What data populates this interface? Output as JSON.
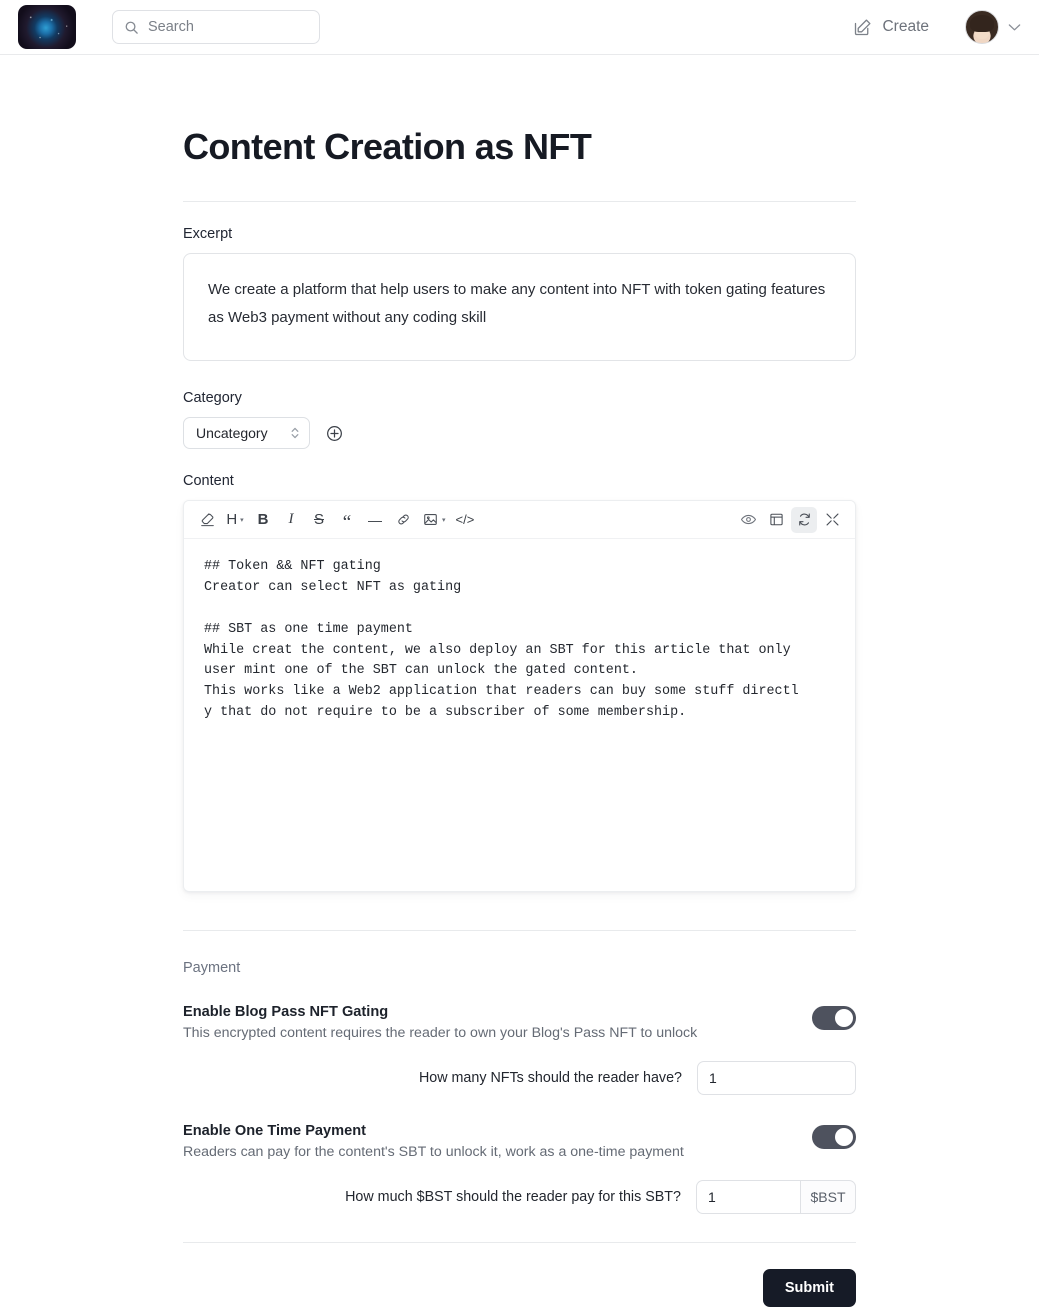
{
  "header": {
    "logo_alt": "app-logo",
    "search": {
      "placeholder": "Search"
    },
    "create_label": "Create",
    "account_caret": "⌄"
  },
  "page": {
    "title": "Content Creation as NFT"
  },
  "excerpt": {
    "label": "Excerpt",
    "value": "We create a platform that help users to make any content into NFT with token gating features as Web3 payment without any coding skill",
    "placeholder": "Excerpt"
  },
  "category": {
    "label": "Category",
    "selected": "Uncategory",
    "options": [
      "Uncategory"
    ],
    "add_button_title": "Add category"
  },
  "content": {
    "label": "Content",
    "toolbar_left": [
      {
        "name": "clear-format-icon",
        "label": ""
      },
      {
        "name": "heading-icon",
        "label": "H",
        "caret": "▾"
      },
      {
        "name": "bold-icon",
        "label": "B"
      },
      {
        "name": "italic-icon",
        "label": "I"
      },
      {
        "name": "strikethrough-icon",
        "label": "S"
      },
      {
        "name": "blockquote-icon",
        "label": "“"
      },
      {
        "name": "horizontal-rule-icon",
        "label": "—"
      },
      {
        "name": "link-icon",
        "label": ""
      },
      {
        "name": "image-icon",
        "label": "",
        "caret": "▾"
      },
      {
        "name": "code-icon",
        "label": "</>"
      }
    ],
    "toolbar_right": [
      {
        "name": "preview-eye-icon",
        "active": false
      },
      {
        "name": "split-view-icon",
        "active": false
      },
      {
        "name": "sync-refresh-icon",
        "active": true
      },
      {
        "name": "fullscreen-icon",
        "active": false
      }
    ],
    "markdown": "## Token && NFT gating\nCreator can select NFT as gating\n\n## SBT as one time payment\nWhile creat the content, we also deploy an SBT for this article that only\nuser mint one of the SBT can unlock the gated content.\nThis works like a Web2 application that readers can buy some stuff directl\ny that do not require to be a subscriber of some membership."
  },
  "payment": {
    "section_label": "Payment",
    "blocks": [
      {
        "title": "Enable Blog Pass NFT Gating",
        "description": "This encrypted content requires the reader to own your Blog's Pass NFT to unlock",
        "toggle_on": true,
        "question": "How many NFTs should the reader have?",
        "value": "1",
        "addon": ""
      },
      {
        "title": "Enable One Time Payment",
        "description": "Readers can pay for the content's SBT to unlock it, work as a one-time payment",
        "toggle_on": true,
        "question": "How much $BST should the reader pay for this SBT?",
        "value": "1",
        "addon": "$BST"
      }
    ]
  },
  "footer": {
    "submit_label": "Submit"
  },
  "colors": {
    "accent_dark": "#161b27",
    "toggle_on": "#4e525e",
    "border": "#dfe1e5",
    "muted_text": "#656b75"
  }
}
